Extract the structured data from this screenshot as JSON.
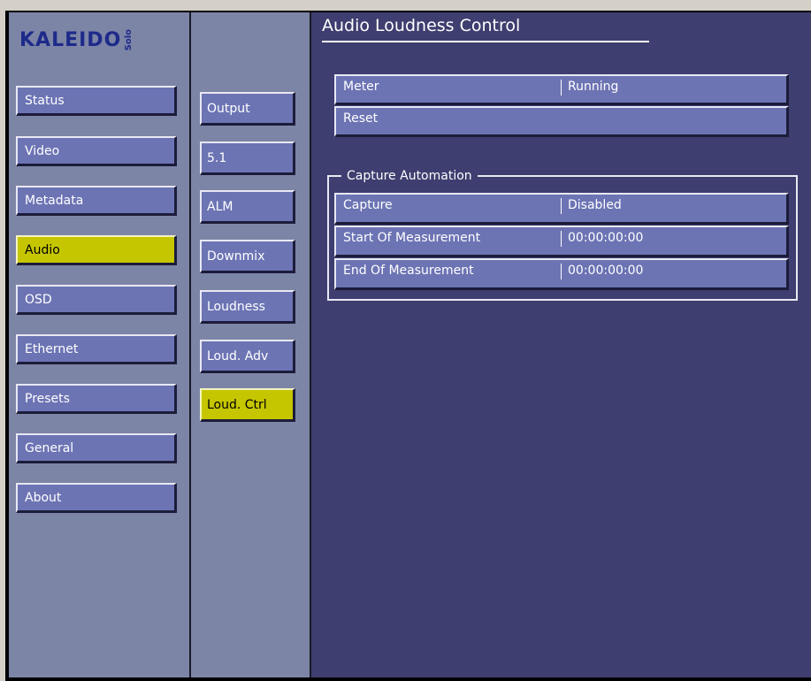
{
  "logo": {
    "main": "KALEIDO",
    "sub": "Solo"
  },
  "left_nav": {
    "items": [
      {
        "label": "Status",
        "active": false
      },
      {
        "label": "Video",
        "active": false
      },
      {
        "label": "Metadata",
        "active": false
      },
      {
        "label": "Audio",
        "active": true
      },
      {
        "label": "OSD",
        "active": false
      },
      {
        "label": "Ethernet",
        "active": false
      },
      {
        "label": "Presets",
        "active": false
      },
      {
        "label": "General",
        "active": false
      },
      {
        "label": "About",
        "active": false
      }
    ]
  },
  "sub_nav": {
    "items": [
      {
        "label": "Output",
        "active": false
      },
      {
        "label": "5.1",
        "active": false
      },
      {
        "label": "ALM",
        "active": false
      },
      {
        "label": "Downmix",
        "active": false
      },
      {
        "label": "Loudness",
        "active": false
      },
      {
        "label": "Loud. Adv",
        "active": false
      },
      {
        "label": "Loud. Ctrl",
        "active": true
      }
    ]
  },
  "main": {
    "title": "Audio Loudness Control",
    "rows": [
      {
        "label": "Meter",
        "value": "Running"
      },
      {
        "label": "Reset",
        "value": ""
      }
    ],
    "capture_group": {
      "title": "Capture Automation",
      "rows": [
        {
          "label": "Capture",
          "value": "Disabled"
        },
        {
          "label": "Start Of Measurement",
          "value": "00:00:00:00"
        },
        {
          "label": "End Of Measurement",
          "value": "00:00:00:00"
        }
      ]
    }
  },
  "colors": {
    "panel_gray": "#7d85a6",
    "main_bg": "#3e3e70",
    "button": "#6c74b4",
    "active": "#c6c600"
  }
}
